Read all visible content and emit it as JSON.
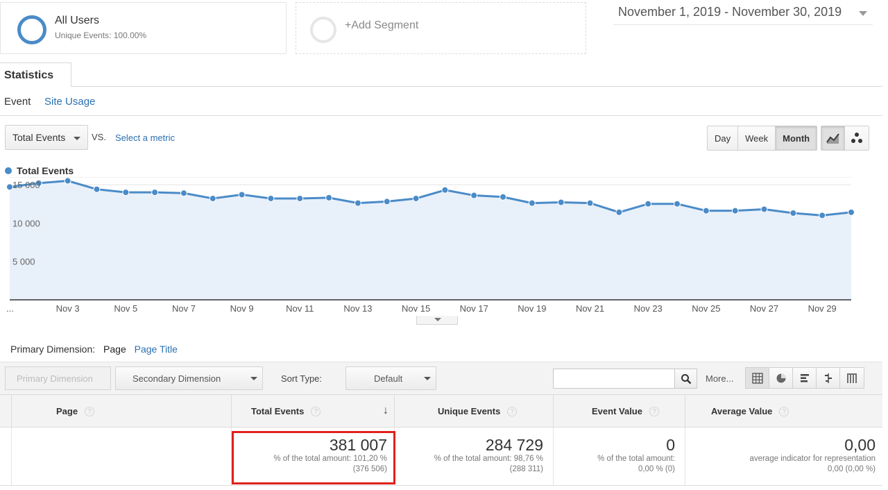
{
  "segments": {
    "all_users": {
      "title": "All Users",
      "subtitle": "Unique Events: 100.00%"
    },
    "add": {
      "label": "+Add Segment"
    }
  },
  "date_range": "November 1, 2019 - November 30, 2019",
  "tabs": {
    "statistics": "Statistics"
  },
  "subtabs": {
    "event": "Event",
    "site_usage": "Site Usage"
  },
  "metric": {
    "selected": "Total Events",
    "vs": "VS.",
    "select_metric": "Select a metric"
  },
  "granularity": {
    "day": "Day",
    "week": "Week",
    "month": "Month",
    "active": "Month"
  },
  "colors": {
    "accent": "#4a8bc8",
    "link": "#2a6fb0",
    "highlight": "#e0201c"
  },
  "chart_data": {
    "type": "line",
    "series": [
      {
        "name": "Total Events",
        "x": [
          "Nov 1",
          "Nov 2",
          "Nov 3",
          "Nov 4",
          "Nov 5",
          "Nov 6",
          "Nov 7",
          "Nov 8",
          "Nov 9",
          "Nov 10",
          "Nov 11",
          "Nov 12",
          "Nov 13",
          "Nov 14",
          "Nov 15",
          "Nov 16",
          "Nov 17",
          "Nov 18",
          "Nov 19",
          "Nov 20",
          "Nov 21",
          "Nov 22",
          "Nov 23",
          "Nov 24",
          "Nov 25",
          "Nov 26",
          "Nov 27",
          "Nov 28",
          "Nov 29",
          "Nov 30"
        ],
        "values": [
          14700,
          15200,
          15500,
          14400,
          14000,
          14000,
          13900,
          13200,
          13700,
          13200,
          13200,
          13300,
          12600,
          12800,
          13200,
          14300,
          13600,
          13400,
          12600,
          12700,
          12600,
          11400,
          12500,
          12500,
          11600,
          11600,
          11800,
          11300,
          11000,
          11400
        ]
      }
    ],
    "x_tick_labels": [
      "...",
      "Nov 3",
      "Nov 5",
      "Nov 7",
      "Nov 9",
      "Nov 11",
      "Nov 13",
      "Nov 15",
      "Nov 17",
      "Nov 19",
      "Nov 21",
      "Nov 23",
      "Nov 25",
      "Nov 27",
      "Nov 29"
    ],
    "y_tick_labels": [
      "5 000",
      "10 000",
      "15 000"
    ],
    "yticks": [
      5000,
      10000,
      15000
    ],
    "ylim": [
      0,
      16000
    ],
    "grid": true,
    "legend": "top-left",
    "area_fill": true
  },
  "table": {
    "primary_dimension_label": "Primary Dimension:",
    "dimension_page": "Page",
    "dimension_page_title": "Page Title",
    "toolbar": {
      "primary_dimension": "Primary Dimension",
      "secondary_dimension": "Secondary Dimension",
      "sort_type_label": "Sort Type:",
      "sort_default": "Default",
      "search_placeholder": "",
      "more": "More..."
    },
    "columns": {
      "page": "Page",
      "total_events": "Total Events",
      "unique_events": "Unique Events",
      "event_value": "Event Value",
      "average_value": "Average Value"
    },
    "help_icon": "?",
    "totals": {
      "total_events": {
        "value": "381 007",
        "line1": "% of the total amount: 101,20 %",
        "line2": "(376 506)"
      },
      "unique_events": {
        "value": "284 729",
        "line1": "% of the total amount:  98,76 %",
        "line2": "(288 311)"
      },
      "event_value": {
        "value": "0",
        "line1": "% of the total amount:",
        "line2": "0,00 % (0)"
      },
      "average_value": {
        "value": "0,00",
        "line1": "average indicator for representation",
        "line2": "0,00 (0,00 %)"
      }
    }
  }
}
